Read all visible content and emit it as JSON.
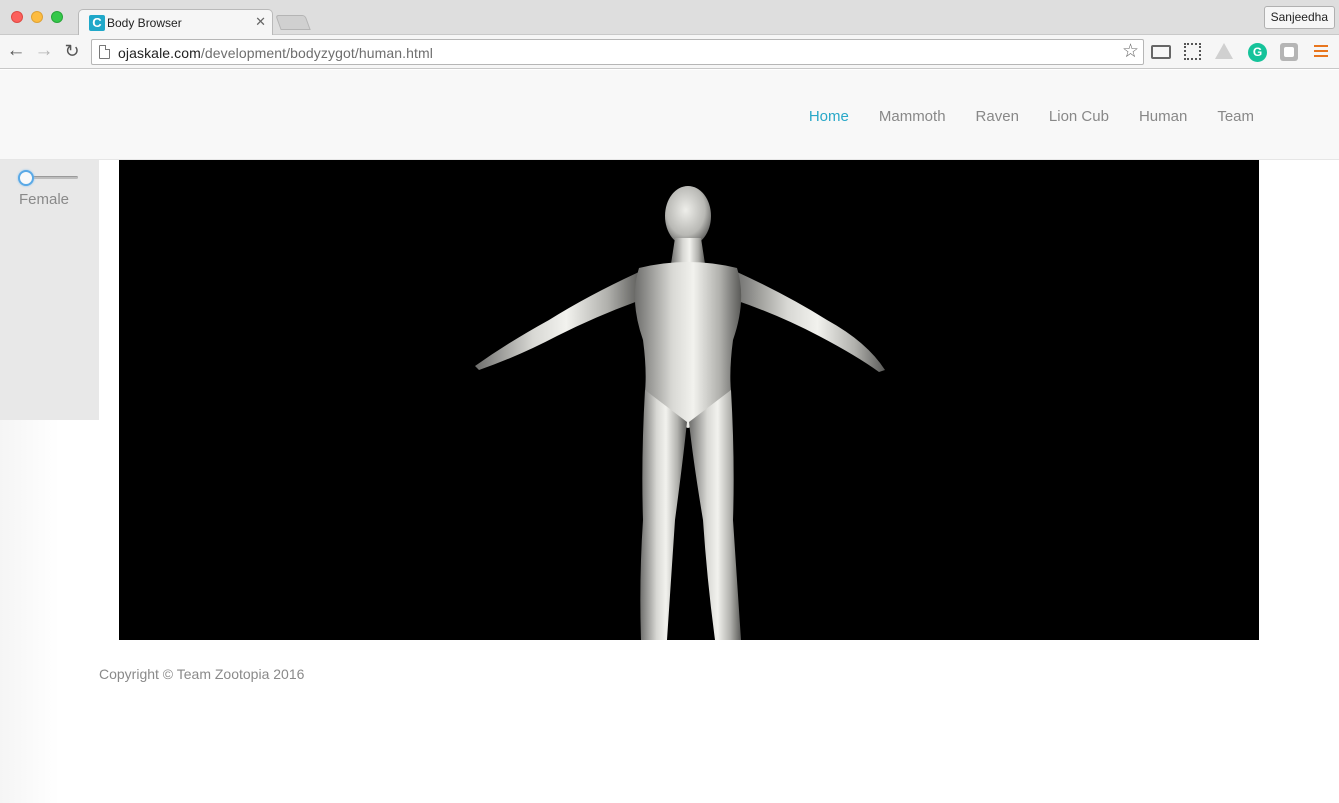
{
  "browser": {
    "tab_title": "Body Browser",
    "tab_favicon_letter": "C",
    "profile_name": "Sanjeedha",
    "url_domain": "ojaskale.com",
    "url_path": "/development/bodyzygot/human.html"
  },
  "site": {
    "nav": [
      {
        "label": "Home",
        "active": true
      },
      {
        "label": "Mammoth",
        "active": false
      },
      {
        "label": "Raven",
        "active": false
      },
      {
        "label": "Lion Cub",
        "active": false
      },
      {
        "label": "Human",
        "active": false
      },
      {
        "label": "Team",
        "active": false
      }
    ],
    "slider": {
      "label": "Female",
      "value": 0
    },
    "footer": "Copyright © Team Zootopia 2016",
    "colors": {
      "accent": "#29a8c8",
      "viewport_bg": "#000000",
      "model": "#c8c8c4"
    }
  },
  "icons": [
    "back-icon",
    "forward-icon",
    "reload-icon",
    "page-icon",
    "star-icon",
    "cast-icon",
    "zoom-extension-icon",
    "drive-icon",
    "grammarly-icon",
    "shield-extension-icon",
    "menu-icon",
    "close-icon"
  ]
}
